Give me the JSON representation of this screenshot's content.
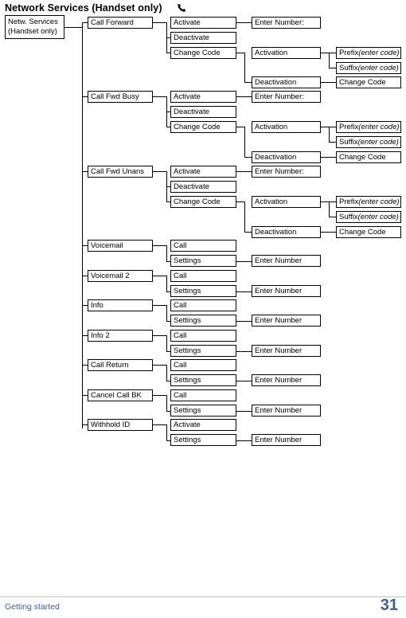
{
  "title": "Network Services (Handset only)",
  "title_icon": "phone-handset-icon",
  "footer": {
    "left": "Getting started",
    "page": "31"
  },
  "root": {
    "line1": "Netw. Services",
    "line2": "(Handset only)"
  },
  "nodes": {
    "call_forward": "Call Forward",
    "call_fwd_busy": "Call Fwd Busy",
    "call_fwd_unans": "Call Fwd Unans",
    "voicemail": "Voicemail",
    "voicemail2": "Voicemail 2",
    "info": "Info",
    "info2": "Info 2",
    "call_return": "Call Return",
    "cancel_call_bk": "Cancel Call BK",
    "withhold_id": "Withhold ID",
    "activate": "Activate",
    "deactivate": "Deactivate",
    "change_code": "Change Code",
    "activation": "Activation",
    "deactivation": "Deactivation",
    "enter_number_colon": "Enter Number:",
    "enter_number": "Enter Number",
    "call": "Call",
    "settings": "Settings",
    "prefix_label": "Prefix ",
    "prefix_hint": "(enter code)",
    "suffix_label": "Suffix ",
    "suffix_hint": "(enter code)"
  }
}
